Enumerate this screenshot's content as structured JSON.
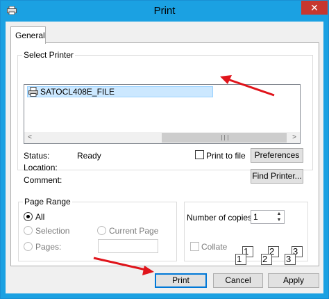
{
  "window": {
    "title": "Print",
    "close_glyph": "✕"
  },
  "tabs": [
    {
      "label": "General"
    }
  ],
  "select_printer": {
    "legend": "Select Printer",
    "printers": [
      {
        "name": "SATOCL408E_FILE",
        "selected": true
      }
    ],
    "scroll_left": "<",
    "scroll_right": ">",
    "scroll_grip": "III"
  },
  "status": {
    "status_label": "Status:",
    "status_value": "Ready",
    "location_label": "Location:",
    "location_value": "",
    "comment_label": "Comment:",
    "comment_value": ""
  },
  "print_to_file": {
    "label": "Print to file",
    "checked": false
  },
  "buttons": {
    "preferences": "Preferences",
    "find_printer": "Find Printer...",
    "print": "Print",
    "cancel": "Cancel",
    "apply": "Apply"
  },
  "page_range": {
    "legend": "Page Range",
    "all": "All",
    "selection": "Selection",
    "current_page": "Current Page",
    "pages": "Pages:",
    "pages_value": "",
    "selected_option": "All"
  },
  "copies": {
    "label": "Number of copies:",
    "value": "1",
    "collate_label": "Collate",
    "collate_checked": false,
    "collate_pages": [
      "1",
      "1",
      "2",
      "2",
      "3",
      "3"
    ]
  },
  "colors": {
    "accent": "#1ba1e2",
    "close": "#c7372f",
    "selection": "#cce8ff",
    "annotation_arrow": "#e0141b"
  },
  "icons": {
    "app": "printer-icon",
    "printer_item": "printer-icon"
  }
}
